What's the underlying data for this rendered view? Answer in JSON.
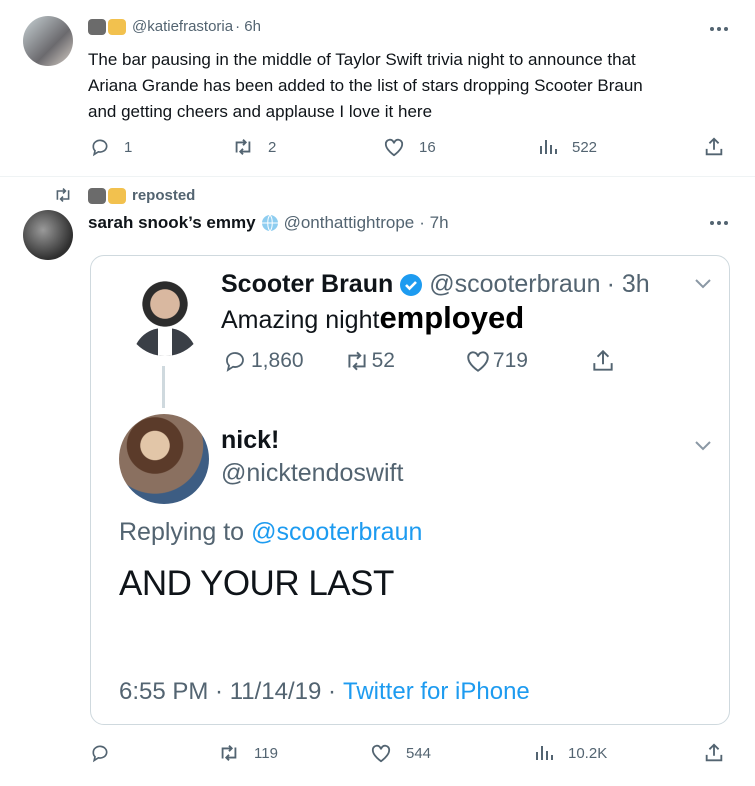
{
  "tweet1": {
    "handle": "@katiefrastoria",
    "time": "· 6h",
    "text_line1": "The bar pausing in the middle of Taylor Swift trivia night to announce that",
    "text_line2": "Ariana Grande has been added to the list of stars dropping Scooter Braun",
    "text_line3": "and getting cheers and applause I love it here",
    "replies": "1",
    "retweets": "2",
    "likes": "16",
    "views": "522"
  },
  "repost": {
    "label": "reposted",
    "name": "sarah snook’s emmy",
    "handle": "@onthattightrope",
    "time": "· 7h",
    "retweets": "119",
    "likes": "544",
    "views": "10.2K"
  },
  "quoted": {
    "top": {
      "name": "Scooter Braun",
      "handle": "@scooterbraun",
      "time": "· 3h",
      "text": "Amazing night",
      "overlay": "employed",
      "replies": "1,860",
      "retweets": "52",
      "likes": "719"
    },
    "reply": {
      "name": "nick!",
      "handle": "@nicktendoswift",
      "replying_prefix": "Replying to",
      "replying_handle": "@scooterbraun",
      "text": "AND YOUR LAST",
      "date": "6:55 PM · 11/14/19 ·",
      "source": "Twitter for iPhone"
    }
  },
  "colors": {
    "accent": "#1d9bf0",
    "muted": "#536471",
    "verified": "#1d9bf0"
  }
}
